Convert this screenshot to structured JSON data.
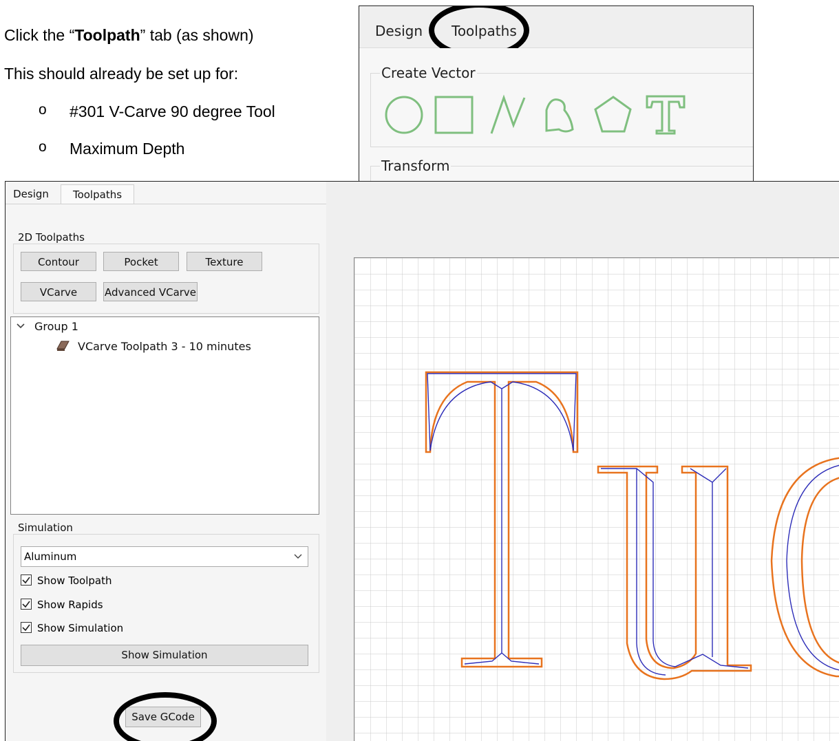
{
  "doc": {
    "line1_pre": "Click the “",
    "line1_bold": "Toolpath",
    "line1_post": "” tab (as shown)",
    "line2": "This should already be set up for:",
    "bullet_marker": "o",
    "bullets": [
      "#301 V-Carve 90 degree Tool",
      "Maximum Depth"
    ]
  },
  "inset": {
    "tabs": [
      "Design",
      "Toolpaths"
    ],
    "create_vector_label": "Create Vector",
    "transform_label": "Transform",
    "vector_icons": [
      "circle-icon",
      "rectangle-icon",
      "polyline-icon",
      "curve-icon",
      "polygon-icon",
      "text-icon"
    ],
    "icon_color": "#7fbf7f"
  },
  "app": {
    "tabs": [
      "Design",
      "Toolpaths"
    ],
    "toolpaths_group_label": "2D Toolpaths",
    "buttons": {
      "contour": "Contour",
      "pocket": "Pocket",
      "texture": "Texture",
      "vcarve": "VCarve",
      "advanced_vcarve": "Advanced VCarve"
    },
    "tree": {
      "group": "Group 1",
      "item": "VCarve Toolpath 3 - 10 minutes"
    },
    "simulation": {
      "label": "Simulation",
      "material": "Aluminum",
      "checkboxes": [
        {
          "label": "Show Toolpath",
          "checked": true
        },
        {
          "label": "Show Rapids",
          "checked": true
        },
        {
          "label": "Show Simulation",
          "checked": true
        }
      ],
      "button": "Show Simulation"
    },
    "save_button": "Save GCode",
    "colors": {
      "outline": "#e8731e",
      "toolpath": "#2d2db8",
      "grid": "#c8c8c8"
    }
  }
}
